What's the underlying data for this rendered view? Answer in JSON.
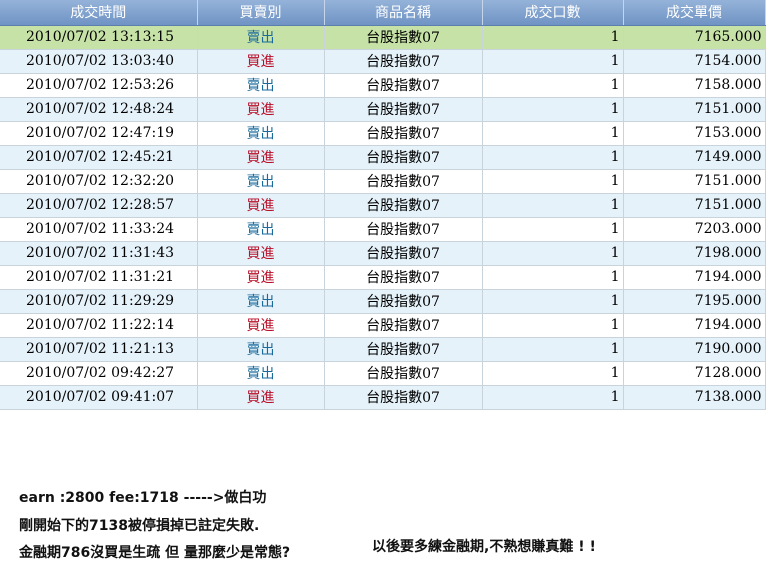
{
  "grid": {
    "columns": [
      "成交時間",
      "買賣別",
      "商品名稱",
      "成交口數",
      "成交單價"
    ],
    "rows": [
      {
        "time": "2010/07/02 13:13:15",
        "side": "賣出",
        "side_type": "sell",
        "product": "台股指數07",
        "qty": "1",
        "price": "7165.000",
        "selected": true
      },
      {
        "time": "2010/07/02 13:03:40",
        "side": "買進",
        "side_type": "buy",
        "product": "台股指數07",
        "qty": "1",
        "price": "7154.000"
      },
      {
        "time": "2010/07/02 12:53:26",
        "side": "賣出",
        "side_type": "sell",
        "product": "台股指數07",
        "qty": "1",
        "price": "7158.000"
      },
      {
        "time": "2010/07/02 12:48:24",
        "side": "買進",
        "side_type": "buy",
        "product": "台股指數07",
        "qty": "1",
        "price": "7151.000"
      },
      {
        "time": "2010/07/02 12:47:19",
        "side": "賣出",
        "side_type": "sell",
        "product": "台股指數07",
        "qty": "1",
        "price": "7153.000"
      },
      {
        "time": "2010/07/02 12:45:21",
        "side": "買進",
        "side_type": "buy",
        "product": "台股指數07",
        "qty": "1",
        "price": "7149.000"
      },
      {
        "time": "2010/07/02 12:32:20",
        "side": "賣出",
        "side_type": "sell",
        "product": "台股指數07",
        "qty": "1",
        "price": "7151.000"
      },
      {
        "time": "2010/07/02 12:28:57",
        "side": "買進",
        "side_type": "buy",
        "product": "台股指數07",
        "qty": "1",
        "price": "7151.000"
      },
      {
        "time": "2010/07/02 11:33:24",
        "side": "賣出",
        "side_type": "sell",
        "product": "台股指數07",
        "qty": "1",
        "price": "7203.000"
      },
      {
        "time": "2010/07/02 11:31:43",
        "side": "買進",
        "side_type": "buy",
        "product": "台股指數07",
        "qty": "1",
        "price": "7198.000"
      },
      {
        "time": "2010/07/02 11:31:21",
        "side": "買進",
        "side_type": "buy",
        "product": "台股指數07",
        "qty": "1",
        "price": "7194.000"
      },
      {
        "time": "2010/07/02 11:29:29",
        "side": "賣出",
        "side_type": "sell",
        "product": "台股指數07",
        "qty": "1",
        "price": "7195.000"
      },
      {
        "time": "2010/07/02 11:22:14",
        "side": "買進",
        "side_type": "buy",
        "product": "台股指數07",
        "qty": "1",
        "price": "7194.000"
      },
      {
        "time": "2010/07/02 11:21:13",
        "side": "賣出",
        "side_type": "sell",
        "product": "台股指數07",
        "qty": "1",
        "price": "7190.000"
      },
      {
        "time": "2010/07/02 09:42:27",
        "side": "賣出",
        "side_type": "sell",
        "product": "台股指數07",
        "qty": "1",
        "price": "7128.000"
      },
      {
        "time": "2010/07/02 09:41:07",
        "side": "買進",
        "side_type": "buy",
        "product": "台股指數07",
        "qty": "1",
        "price": "7138.000"
      }
    ]
  },
  "colors": {
    "header_bg": "#7d9dcb",
    "row_alt_bg": "#e6f2fa",
    "row_selected_bg": "#c6e2a6",
    "sell_text": "#1a6a9c",
    "buy_text": "#b8102a"
  },
  "notes": {
    "line1": "earn :2800  fee:1718 ----->做白功",
    "line2": "剛開始下的7138被停損掉已註定失敗.",
    "line3": "金融期786沒買是生疏 但 量那麼少是常態?",
    "line4": "以後要多練金融期,不熟想賺真難 ! !"
  }
}
